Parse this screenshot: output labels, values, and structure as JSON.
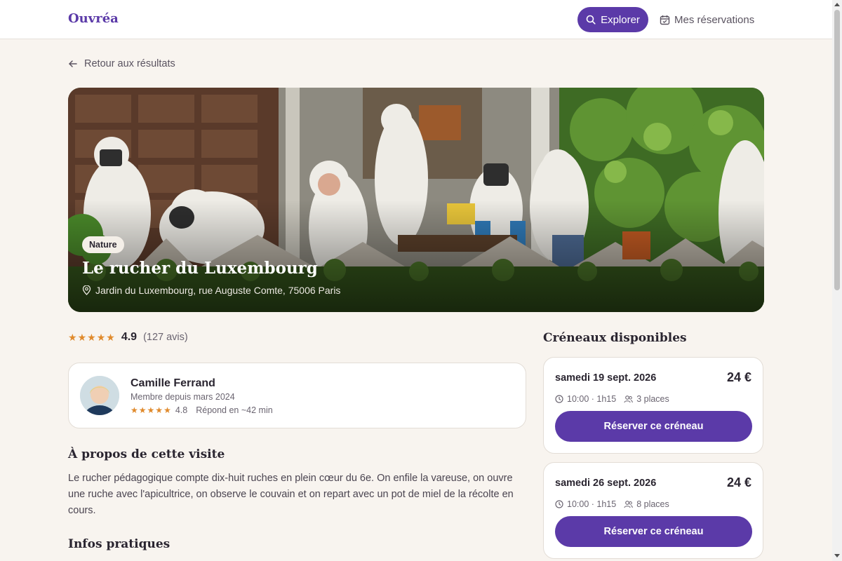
{
  "header": {
    "brand": "Ouvréa",
    "nav_explore": "Explorer",
    "nav_reservations": "Mes réservations"
  },
  "back_link": "Retour aux résultats",
  "hero": {
    "tag": "Nature",
    "title": "Le rucher du Luxembourg",
    "location": "Jardin du Luxembourg, rue Auguste Comte, 75006 Paris"
  },
  "rating": {
    "value": "4.9",
    "count": "(127 avis)",
    "stars": 5
  },
  "host": {
    "name": "Camille Ferrand",
    "since": "Membre depuis mars 2024",
    "rating": "4.8",
    "response": "Répond en ~42 min"
  },
  "about": {
    "title": "À propos de cette visite",
    "text": "Le rucher pédagogique compte dix-huit ruches en plein cœur du 6e. On enfile la vareuse, on ouvre une ruche avec l'apicultrice, on observe le couvain et on repart avec un pot de miel de la récolte en cours."
  },
  "practical": {
    "title": "Infos pratiques"
  },
  "slots": {
    "title": "Créneaux disponibles",
    "items": [
      {
        "date": "samedi 19 sept. 2026",
        "price": "24 €",
        "time": "10:00 · 1h15",
        "places": "3 places",
        "button": "Réserver ce créneau"
      },
      {
        "date": "samedi 26 sept. 2026",
        "price": "24 €",
        "time": "10:00 · 1h15",
        "places": "8 places",
        "button": "Réserver ce créneau"
      }
    ]
  },
  "colors": {
    "accent": "#5b3aa8",
    "star": "#e08a2c",
    "background": "#f8f4ef"
  }
}
